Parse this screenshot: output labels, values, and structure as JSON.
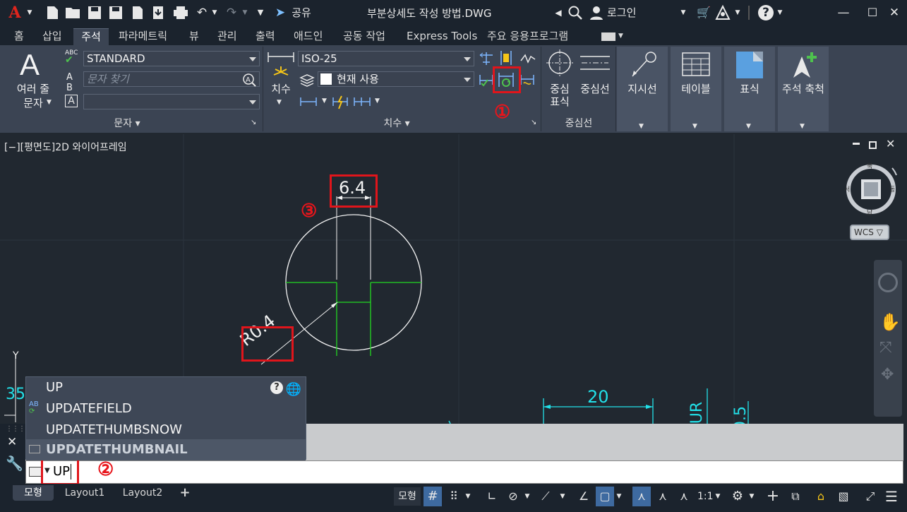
{
  "titlebar": {
    "share_label": "공유",
    "title": "부분상세도 작성 방법.DWG",
    "login_label": "로그인"
  },
  "menu": {
    "tabs": [
      "홈",
      "삽입",
      "주석",
      "파라메트릭",
      "뷰",
      "관리",
      "출력",
      "애드인",
      "공동 작업",
      "Express Tools",
      "주요 응용프로그램"
    ]
  },
  "ribbon": {
    "text_panel": {
      "multiline_label_1": "여러 줄",
      "multiline_label_2": "문자",
      "style_value": "STANDARD",
      "find_placeholder": "문자 찾기",
      "title": "문자"
    },
    "dim_panel": {
      "dim_label": "치수",
      "style_value": "ISO-25",
      "layer_value": "현재 사용",
      "title": "치수"
    },
    "center_panel": {
      "centermark_label_1": "중심",
      "centermark_label_2": "표식",
      "centerline_label": "중심선",
      "title": "중심선"
    },
    "leader_label": "지시선",
    "table_label": "테이블",
    "markup_label": "표식",
    "annoscale_label": "주석 축척"
  },
  "viewport": {
    "label": "[−][평면도]2D 와이어프레임",
    "dim_width": "6.4",
    "dim_radius": "R0.4",
    "dim_bottom": "20",
    "dim_partial_1": "UR",
    "dim_partial_2": "0.5",
    "dim_left": "35",
    "wcs_label": "WCS",
    "compass": {
      "n": "북",
      "s": "남",
      "e": "동",
      "w": "서"
    }
  },
  "annotations": {
    "one": "①",
    "two": "②",
    "three": "③"
  },
  "autocomplete": {
    "items": [
      "UP",
      "UPDATEFIELD",
      "UPDATETHUMBSNOW",
      "UPDATETHUMBNAIL"
    ]
  },
  "command": {
    "value": "UP"
  },
  "status": {
    "tabs": [
      "모형",
      "Layout1",
      "Layout2"
    ],
    "model_label": "모형",
    "scale_label": "1:1"
  }
}
